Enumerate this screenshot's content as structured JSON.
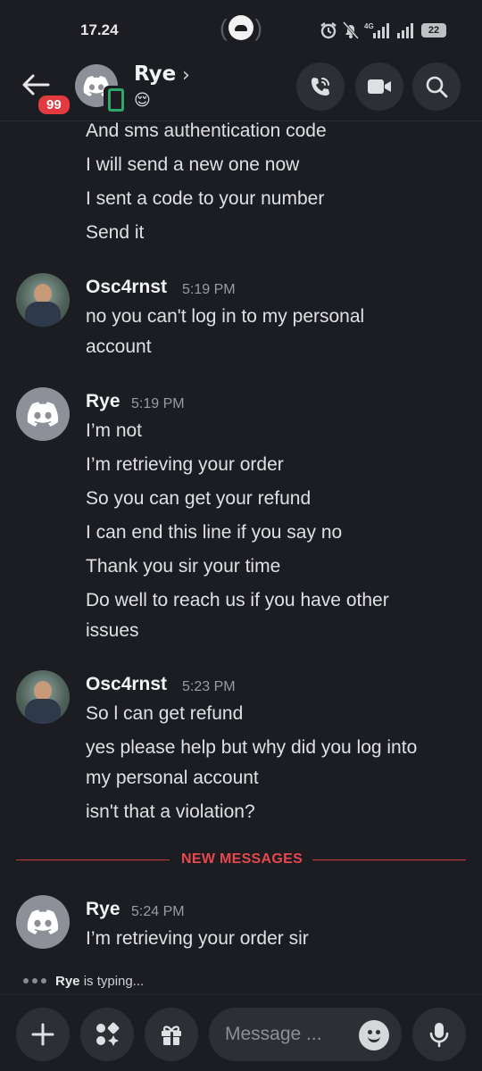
{
  "status_bar": {
    "time": "17.24",
    "network": "4G",
    "battery": "22"
  },
  "header": {
    "back_badge": "99",
    "name": "Rye",
    "chevron": "›",
    "status_emoji": "😌",
    "icons": [
      "phone-icon",
      "video-icon",
      "search-icon"
    ]
  },
  "messages": {
    "continuation": [
      "And sms authentication code",
      "I will send a new one now",
      "I sent a code to your number",
      "Send it"
    ],
    "groups": [
      {
        "author": "Osc4rnst",
        "time": "5:19 PM",
        "lines": [
          "no you can't log in to my personal",
          "account"
        ]
      },
      {
        "author": "Rye",
        "time": "5:19 PM",
        "lines": [
          "I’m not",
          "I’m retrieving your order",
          "So you can get your refund",
          "I can end this line if you say no",
          "Thank you sir your time",
          "Do well to reach us if you have other",
          "issues"
        ]
      },
      {
        "author": "Osc4rnst",
        "time": "5:23 PM",
        "lines": [
          "So l can get  refund",
          "yes please help but why did you log into",
          "my personal account",
          "isn't that a violation?"
        ]
      },
      {
        "author": "Rye",
        "time": "5:24 PM",
        "lines": [
          "I’m retrieving your order sir"
        ]
      }
    ],
    "new_messages_label": "NEW MESSAGES"
  },
  "typing": {
    "user": "Rye",
    "text": " is typing..."
  },
  "composer": {
    "placeholder": "Message ..."
  },
  "colors": {
    "background": "#1c1d22",
    "accent_red": "#e5484d",
    "online_green": "#2fa76a"
  }
}
